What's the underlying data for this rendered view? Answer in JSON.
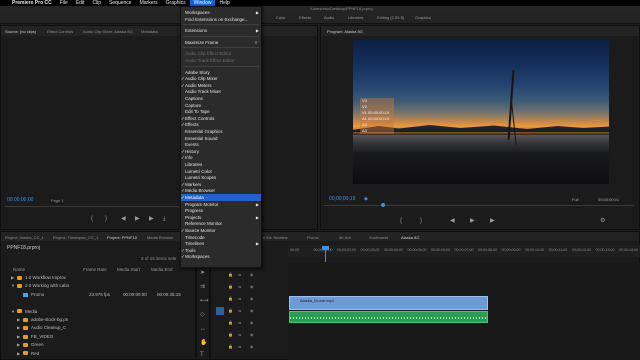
{
  "menubar": {
    "app": "Premiere Pro CC",
    "items": [
      "File",
      "Edit",
      "Clip",
      "Sequence",
      "Markers",
      "Graphics",
      "Window",
      "Help"
    ],
    "active": "Window"
  },
  "titlebar": {
    "path": "/Users/eric/Desktop/PPNF18.prproj"
  },
  "workspaces": [
    "Color",
    "Effects",
    "Audio",
    "Libraries",
    "Editing (CS5.5)",
    "Graphics"
  ],
  "source_panel": {
    "tabs": [
      "Source: (no clips)",
      "Effect Controls",
      "Audio Clip Mixer: Alaska 8G",
      "Metadata"
    ],
    "timecode": "00;00;00;00",
    "page": "Page 1"
  },
  "program_panel": {
    "tab": "Program: Alaska 8G",
    "timecode_left": "00;00;00;19",
    "fit": "Full",
    "timecode_right": "00;00;00;01",
    "track_overlay": [
      "V3",
      "V2",
      "V1 00:00:00:19",
      "A1 00:00:00:19",
      "A2",
      "A3"
    ]
  },
  "window_menu": {
    "items": [
      {
        "label": "Workspaces",
        "check": false,
        "submenu": true
      },
      {
        "label": "Find Extensions on Exchange...",
        "check": false
      },
      {
        "sep": true
      },
      {
        "label": "Extensions",
        "check": false,
        "submenu": true
      },
      {
        "sep": true
      },
      {
        "label": "Maximize Frame",
        "check": false,
        "shortcut": "⇧`"
      },
      {
        "sep": true
      },
      {
        "label": "Audio Clip Effect Editor",
        "check": false,
        "disabled": true
      },
      {
        "label": "Audio Track Effect Editor",
        "check": false,
        "disabled": true
      },
      {
        "sep": true
      },
      {
        "label": "Adobe Story",
        "check": false
      },
      {
        "label": "Audio Clip Mixer",
        "check": true
      },
      {
        "label": "Audio Meters",
        "check": true
      },
      {
        "label": "Audio Track Mixer",
        "check": false
      },
      {
        "label": "Captions",
        "check": false
      },
      {
        "label": "Capture",
        "check": false
      },
      {
        "label": "Edit To Tape",
        "check": false
      },
      {
        "label": "Effect Controls",
        "check": true
      },
      {
        "label": "Effects",
        "check": true
      },
      {
        "label": "Essential Graphics",
        "check": false
      },
      {
        "label": "Essential Sound",
        "check": false
      },
      {
        "label": "Events",
        "check": false
      },
      {
        "label": "History",
        "check": true
      },
      {
        "label": "Info",
        "check": true
      },
      {
        "label": "Libraries",
        "check": false
      },
      {
        "label": "Lumetri Color",
        "check": false
      },
      {
        "label": "Lumetri Scopes",
        "check": false
      },
      {
        "label": "Markers",
        "check": true
      },
      {
        "label": "Media Browser",
        "check": true
      },
      {
        "label": "Metadata",
        "check": true,
        "highlighted": true
      },
      {
        "label": "Program Monitor",
        "check": false,
        "submenu": true
      },
      {
        "label": "Progress",
        "check": false
      },
      {
        "label": "Projects",
        "check": false,
        "submenu": true
      },
      {
        "label": "Reference Monitor",
        "check": false
      },
      {
        "label": "Source Monitor",
        "check": true
      },
      {
        "label": "Timecode",
        "check": false
      },
      {
        "label": "Timelines",
        "check": false,
        "submenu": true
      },
      {
        "label": "Tools",
        "check": true
      },
      {
        "label": "Workspaces",
        "check": true
      }
    ]
  },
  "project_panel": {
    "tabs": [
      "Project: Alaska_CC_1",
      "Project: Timelapse_CC_1",
      "Project: PPNF18",
      "Media Browser"
    ],
    "active_tab": "Project: PPNF18",
    "file": "PPNF18.prproj",
    "count": "3 of 15 items sele",
    "columns": [
      "Name",
      "Frame Rate",
      "Media Start",
      "Media End"
    ],
    "rows": [
      {
        "name": "1.0 Workflow Improv",
        "type": "folder",
        "indent": 1,
        "expanded": false
      },
      {
        "name": "2.0 Working with Labs",
        "type": "folder",
        "indent": 1,
        "expanded": true
      },
      {
        "name": "Promo",
        "type": "clip",
        "indent": 2,
        "fps": "23.976 fps",
        "start": "00:00:00:00",
        "end": "00:00:35:15"
      },
      {
        "name": "",
        "type": "spacer",
        "indent": 0
      },
      {
        "name": "Media",
        "type": "folder",
        "indent": 1,
        "expanded": true
      },
      {
        "name": "adobe-stock-bg.pn",
        "type": "folder",
        "indent": 2,
        "expanded": false
      },
      {
        "name": "Audio Cleanup_C",
        "type": "folder",
        "indent": 2,
        "expanded": false
      },
      {
        "name": "FB_VIDEO",
        "type": "folder",
        "indent": 2,
        "expanded": false
      },
      {
        "name": "Green",
        "type": "folder",
        "indent": 2,
        "expanded": false
      },
      {
        "name": "Red",
        "type": "folder",
        "indent": 2,
        "expanded": false
      }
    ]
  },
  "timeline": {
    "tabs": [
      "e the Timeline",
      "Promo",
      "5K Arri",
      "Southwest",
      "Alaska 8G"
    ],
    "active_tab": "Alaska 8G",
    "ruler": [
      "00;00",
      "00;00;01;00",
      "00;00;02;00",
      "00;00;03;00",
      "00;00;04;00",
      "00;00;05;00",
      "00;00;06;00",
      "00;00;07;00",
      "00;00;08;00",
      "00;00;09;00",
      "00;00;10;00",
      "00;00;11;00",
      "00;00;12;00",
      "00;00;13;00",
      "00;00;14;00"
    ],
    "clip_label": "Alaska_Drone.mp4"
  },
  "colors": {
    "accent": "#3d8fe8",
    "menu_highlight": "#1f62d0",
    "folder": "#e39b2c",
    "video_clip": "#6e9bd6",
    "audio_clip": "#2e9b55"
  }
}
